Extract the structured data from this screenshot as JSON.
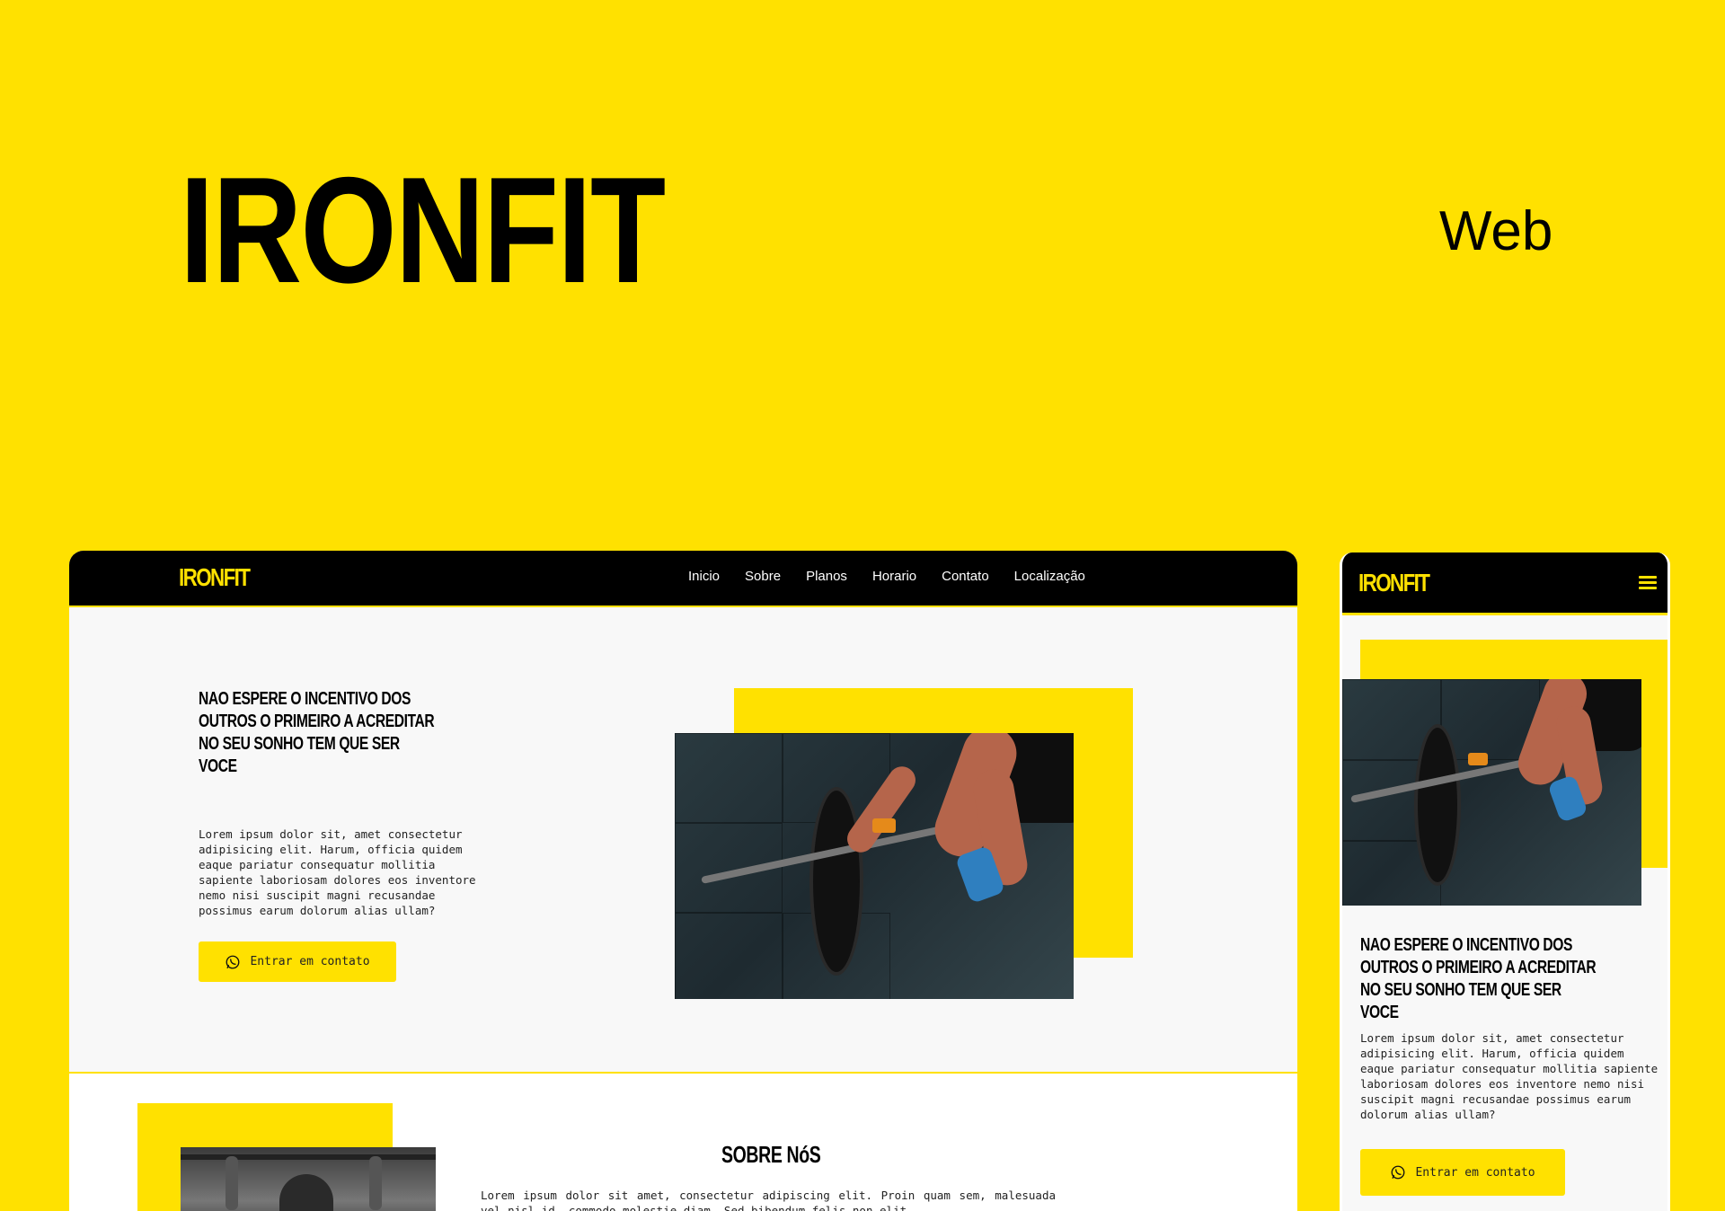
{
  "hero": {
    "title": "IRONFIT",
    "platform": "Web"
  },
  "desktop": {
    "logo": "IRONFIT",
    "nav": [
      "Inicio",
      "Sobre",
      "Planos",
      "Horario",
      "Contato",
      "Localização"
    ],
    "heading": "NAO ESPERE O INCENTIVO DOS OUTROS O PRIMEIRO A ACREDITAR NO SEU SONHO TEM QUE SER VOCE",
    "text": "Lorem ipsum dolor sit, amet consectetur adipisicing elit. Harum, officia quidem eaque pariatur consequatur mollitia sapiente laboriosam dolores eos inventore nemo nisi suscipit magni recusandae possimus earum dolorum alias ullam?",
    "cta": "Entrar em contato",
    "about_title": "SOBRE NóS",
    "about_text": "Lorem ipsum dolor sit amet, consectetur adipiscing elit. Proin quam sem, malesuada vel nisl id, commodo molestie diam. Sed bibendum felis non elit"
  },
  "mobile": {
    "logo": "IRONFIT",
    "heading": "NAO ESPERE O INCENTIVO DOS OUTROS O PRIMEIRO A ACREDITAR NO SEU SONHO TEM QUE SER VOCE",
    "text": "Lorem ipsum dolor sit, amet consectetur adipisicing elit. Harum, officia quidem eaque pariatur consequatur mollitia sapiente laboriosam dolores eos inventore nemo nisi suscipit magni recusandae possimus earum dolorum alias ullam?",
    "cta": "Entrar em contato"
  },
  "icons": {
    "cta": "whatsapp-icon",
    "menu": "hamburger-menu-icon"
  },
  "colors": {
    "brand_yellow": "#FFE100",
    "nav_black": "#000000",
    "page_bg": "#F8F8F8"
  }
}
